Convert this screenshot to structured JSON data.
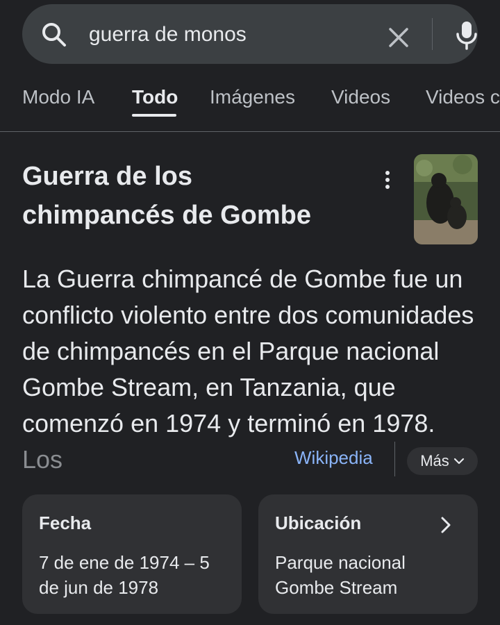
{
  "search": {
    "query": "guerra de monos"
  },
  "tabs": [
    {
      "label": "Modo IA"
    },
    {
      "label": "Todo"
    },
    {
      "label": "Imágenes"
    },
    {
      "label": "Videos"
    },
    {
      "label": "Videos c"
    }
  ],
  "panel": {
    "title": "Guerra de los chimpancés de Gombe",
    "description": "La Guerra chimpancé de Gombe fue un conflicto violento entre dos comunidades de chimpancés en el Parque nacional Gombe Stream, en Tanzania, que comenzó en 1974 y terminó en 1978.",
    "description_fade": "Los",
    "source": "Wikipedia",
    "more_label": "Más"
  },
  "cards": {
    "date": {
      "label": "Fecha",
      "value": "7 de ene de 1974 – 5 de jun de 1978"
    },
    "location": {
      "label": "Ubicación",
      "value": "Parque nacional Gombe Stream"
    }
  },
  "icons": {
    "search": "search-icon",
    "clear": "close-icon",
    "mic": "mic-icon",
    "more": "more-vert-icon",
    "chevron_down": "chevron-down-icon",
    "chevron_right": "chevron-right-icon"
  },
  "colors": {
    "background": "#202124",
    "surface": "#303134",
    "search_bg": "#3c4043",
    "link": "#8ab4f8"
  }
}
